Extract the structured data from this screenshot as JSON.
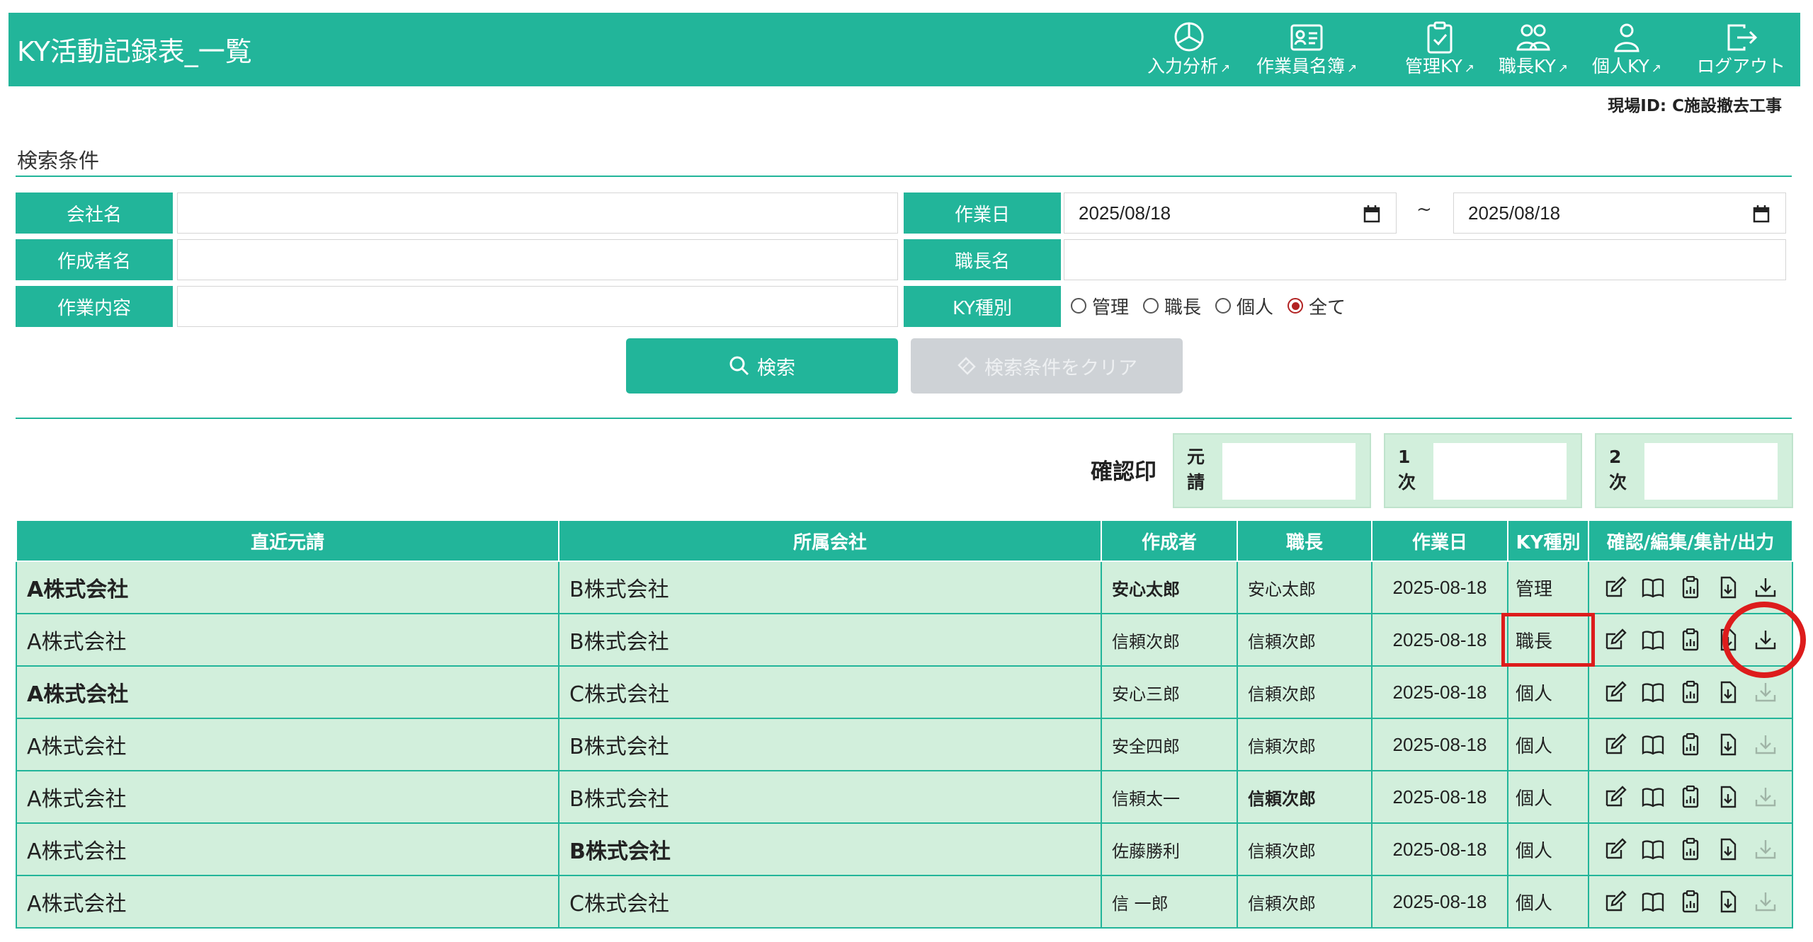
{
  "header": {
    "title": "KY活動記録表_一覧",
    "nav": [
      {
        "label": "入力分析",
        "icon": "pie-chart-icon"
      },
      {
        "label": "作業員名簿",
        "icon": "id-card-icon"
      },
      {
        "label": "管理KY",
        "icon": "clipboard-check-icon"
      },
      {
        "label": "職長KY",
        "icon": "people-icon"
      },
      {
        "label": "個人KY",
        "icon": "person-icon"
      },
      {
        "label": "ログアウト",
        "icon": "logout-icon"
      }
    ],
    "site_id": "現場ID: C施設撤去工事"
  },
  "search": {
    "title": "検索条件",
    "labels": {
      "company": "会社名",
      "author": "作成者名",
      "work_content": "作業内容",
      "work_date": "作業日",
      "foreman": "職長名",
      "ky_type": "KY種別"
    },
    "values": {
      "company": "",
      "author": "",
      "work_content": "",
      "foreman": "",
      "date_from": "2025/08/18",
      "date_to": "2025/08/18"
    },
    "date_separator": "~",
    "ky_options": [
      {
        "label": "管理",
        "checked": false
      },
      {
        "label": "職長",
        "checked": false
      },
      {
        "label": "個人",
        "checked": false
      },
      {
        "label": "全て",
        "checked": true
      }
    ],
    "search_button": "検索",
    "clear_button": "検索条件をクリア"
  },
  "stamps": {
    "label": "確認印",
    "boxes": [
      {
        "tag": "元請"
      },
      {
        "tag": "1次"
      },
      {
        "tag": "2次"
      }
    ]
  },
  "table": {
    "columns": [
      "直近元請",
      "所属会社",
      "作成者",
      "職長",
      "作業日",
      "KY種別",
      "確認/編集/集計/出力"
    ],
    "rows": [
      {
        "prime": "A株式会社",
        "company": "B株式会社",
        "author": "安心太郎",
        "foreman": "安心太郎",
        "date": "2025-08-18",
        "type": "管理",
        "download_enabled": true
      },
      {
        "prime": "A株式会社",
        "company": "B株式会社",
        "author": "信頼次郎",
        "foreman": "信頼次郎",
        "date": "2025-08-18",
        "type": "職長",
        "download_enabled": true
      },
      {
        "prime": "A株式会社",
        "company": "C株式会社",
        "author": "安心三郎",
        "foreman": "信頼次郎",
        "date": "2025-08-18",
        "type": "個人",
        "download_enabled": false
      },
      {
        "prime": "A株式会社",
        "company": "B株式会社",
        "author": "安全四郎",
        "foreman": "信頼次郎",
        "date": "2025-08-18",
        "type": "個人",
        "download_enabled": false
      },
      {
        "prime": "A株式会社",
        "company": "B株式会社",
        "author": "信頼太一",
        "foreman": "信頼次郎",
        "date": "2025-08-18",
        "type": "個人",
        "download_enabled": false
      },
      {
        "prime": "A株式会社",
        "company": "B株式会社",
        "author": "佐藤勝利",
        "foreman": "信頼次郎",
        "date": "2025-08-18",
        "type": "個人",
        "download_enabled": false
      },
      {
        "prime": "A株式会社",
        "company": "C株式会社",
        "author": "信 一郎",
        "foreman": "信頼次郎",
        "date": "2025-08-18",
        "type": "個人",
        "download_enabled": false
      }
    ]
  },
  "colors": {
    "primary": "#22b59a",
    "row_bg": "#d2efdc",
    "annotation": "#dd1c1c"
  }
}
